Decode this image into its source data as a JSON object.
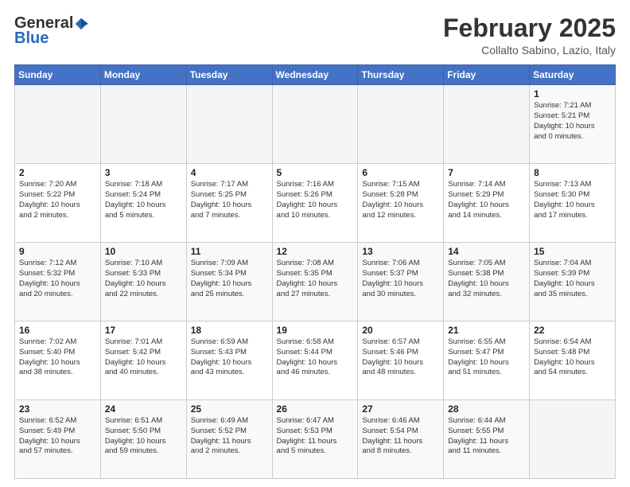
{
  "header": {
    "logo_general": "General",
    "logo_blue": "Blue",
    "month_title": "February 2025",
    "location": "Collalto Sabino, Lazio, Italy"
  },
  "days_of_week": [
    "Sunday",
    "Monday",
    "Tuesday",
    "Wednesday",
    "Thursday",
    "Friday",
    "Saturday"
  ],
  "weeks": [
    [
      {
        "day": "",
        "info": ""
      },
      {
        "day": "",
        "info": ""
      },
      {
        "day": "",
        "info": ""
      },
      {
        "day": "",
        "info": ""
      },
      {
        "day": "",
        "info": ""
      },
      {
        "day": "",
        "info": ""
      },
      {
        "day": "1",
        "info": "Sunrise: 7:21 AM\nSunset: 5:21 PM\nDaylight: 10 hours\nand 0 minutes."
      }
    ],
    [
      {
        "day": "2",
        "info": "Sunrise: 7:20 AM\nSunset: 5:22 PM\nDaylight: 10 hours\nand 2 minutes."
      },
      {
        "day": "3",
        "info": "Sunrise: 7:18 AM\nSunset: 5:24 PM\nDaylight: 10 hours\nand 5 minutes."
      },
      {
        "day": "4",
        "info": "Sunrise: 7:17 AM\nSunset: 5:25 PM\nDaylight: 10 hours\nand 7 minutes."
      },
      {
        "day": "5",
        "info": "Sunrise: 7:16 AM\nSunset: 5:26 PM\nDaylight: 10 hours\nand 10 minutes."
      },
      {
        "day": "6",
        "info": "Sunrise: 7:15 AM\nSunset: 5:28 PM\nDaylight: 10 hours\nand 12 minutes."
      },
      {
        "day": "7",
        "info": "Sunrise: 7:14 AM\nSunset: 5:29 PM\nDaylight: 10 hours\nand 14 minutes."
      },
      {
        "day": "8",
        "info": "Sunrise: 7:13 AM\nSunset: 5:30 PM\nDaylight: 10 hours\nand 17 minutes."
      }
    ],
    [
      {
        "day": "9",
        "info": "Sunrise: 7:12 AM\nSunset: 5:32 PM\nDaylight: 10 hours\nand 20 minutes."
      },
      {
        "day": "10",
        "info": "Sunrise: 7:10 AM\nSunset: 5:33 PM\nDaylight: 10 hours\nand 22 minutes."
      },
      {
        "day": "11",
        "info": "Sunrise: 7:09 AM\nSunset: 5:34 PM\nDaylight: 10 hours\nand 25 minutes."
      },
      {
        "day": "12",
        "info": "Sunrise: 7:08 AM\nSunset: 5:35 PM\nDaylight: 10 hours\nand 27 minutes."
      },
      {
        "day": "13",
        "info": "Sunrise: 7:06 AM\nSunset: 5:37 PM\nDaylight: 10 hours\nand 30 minutes."
      },
      {
        "day": "14",
        "info": "Sunrise: 7:05 AM\nSunset: 5:38 PM\nDaylight: 10 hours\nand 32 minutes."
      },
      {
        "day": "15",
        "info": "Sunrise: 7:04 AM\nSunset: 5:39 PM\nDaylight: 10 hours\nand 35 minutes."
      }
    ],
    [
      {
        "day": "16",
        "info": "Sunrise: 7:02 AM\nSunset: 5:40 PM\nDaylight: 10 hours\nand 38 minutes."
      },
      {
        "day": "17",
        "info": "Sunrise: 7:01 AM\nSunset: 5:42 PM\nDaylight: 10 hours\nand 40 minutes."
      },
      {
        "day": "18",
        "info": "Sunrise: 6:59 AM\nSunset: 5:43 PM\nDaylight: 10 hours\nand 43 minutes."
      },
      {
        "day": "19",
        "info": "Sunrise: 6:58 AM\nSunset: 5:44 PM\nDaylight: 10 hours\nand 46 minutes."
      },
      {
        "day": "20",
        "info": "Sunrise: 6:57 AM\nSunset: 5:46 PM\nDaylight: 10 hours\nand 48 minutes."
      },
      {
        "day": "21",
        "info": "Sunrise: 6:55 AM\nSunset: 5:47 PM\nDaylight: 10 hours\nand 51 minutes."
      },
      {
        "day": "22",
        "info": "Sunrise: 6:54 AM\nSunset: 5:48 PM\nDaylight: 10 hours\nand 54 minutes."
      }
    ],
    [
      {
        "day": "23",
        "info": "Sunrise: 6:52 AM\nSunset: 5:49 PM\nDaylight: 10 hours\nand 57 minutes."
      },
      {
        "day": "24",
        "info": "Sunrise: 6:51 AM\nSunset: 5:50 PM\nDaylight: 10 hours\nand 59 minutes."
      },
      {
        "day": "25",
        "info": "Sunrise: 6:49 AM\nSunset: 5:52 PM\nDaylight: 11 hours\nand 2 minutes."
      },
      {
        "day": "26",
        "info": "Sunrise: 6:47 AM\nSunset: 5:53 PM\nDaylight: 11 hours\nand 5 minutes."
      },
      {
        "day": "27",
        "info": "Sunrise: 6:46 AM\nSunset: 5:54 PM\nDaylight: 11 hours\nand 8 minutes."
      },
      {
        "day": "28",
        "info": "Sunrise: 6:44 AM\nSunset: 5:55 PM\nDaylight: 11 hours\nand 11 minutes."
      },
      {
        "day": "",
        "info": ""
      }
    ]
  ]
}
